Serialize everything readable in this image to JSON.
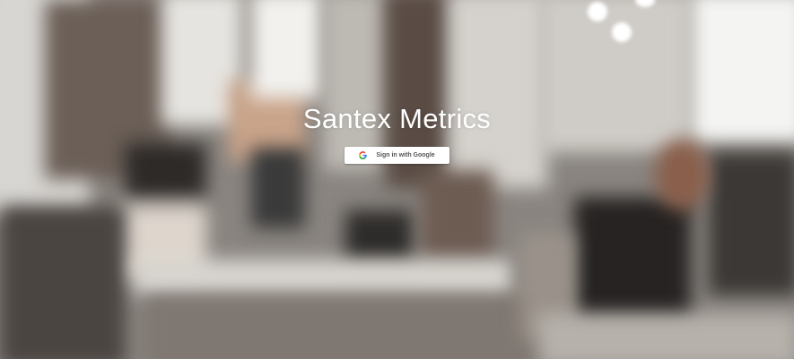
{
  "app": {
    "title": "Santex Metrics"
  },
  "signin": {
    "label": "Sign in with Google",
    "icon": "google-icon"
  },
  "colors": {
    "google_blue": "#4285F4",
    "google_red": "#EA4335",
    "google_yellow": "#FBBC05",
    "google_green": "#34A853"
  }
}
